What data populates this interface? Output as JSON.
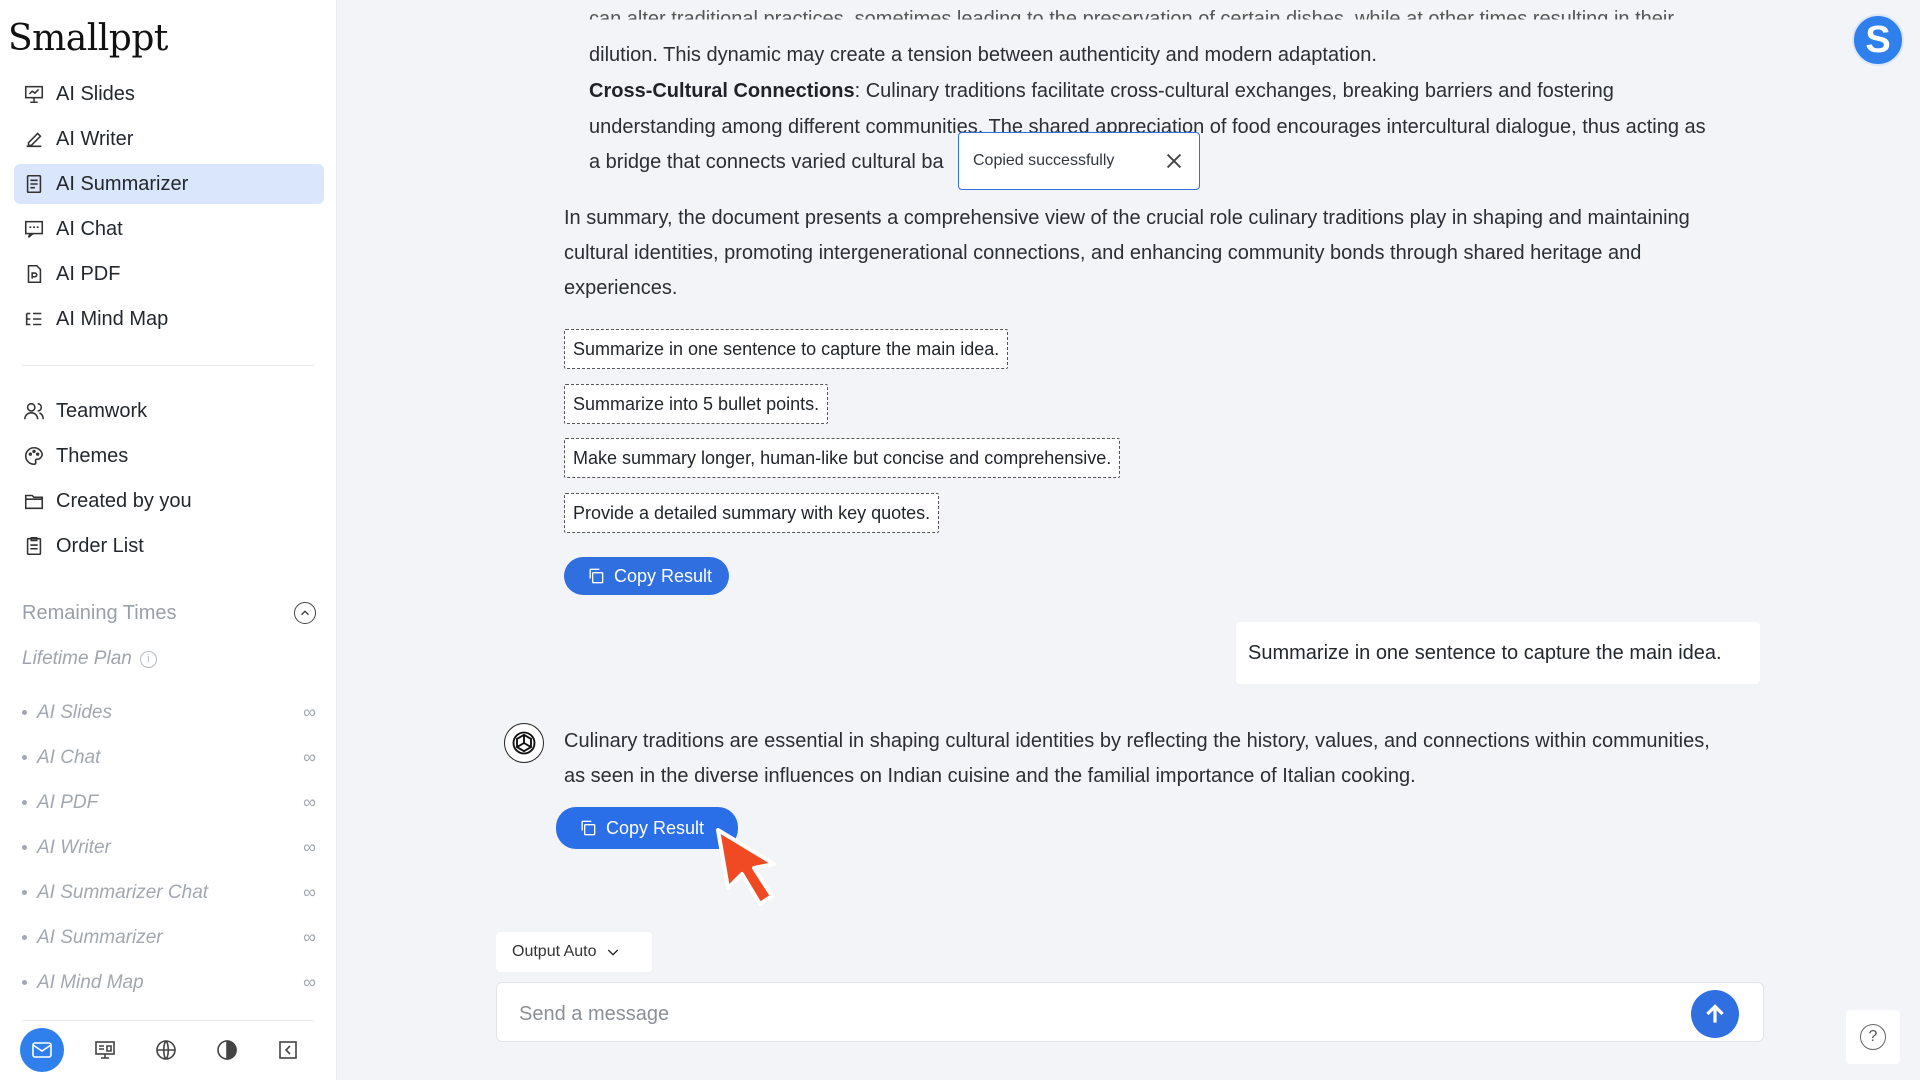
{
  "app": {
    "logo_text": "Smallppt",
    "user_initial": "S",
    "accent": "#2f6fe0"
  },
  "sidebar": {
    "nav_primary": [
      {
        "label": "AI Slides",
        "icon": "presentation-icon"
      },
      {
        "label": "AI Writer",
        "icon": "pen-icon"
      },
      {
        "label": "AI Summarizer",
        "icon": "document-icon",
        "active": true
      },
      {
        "label": "AI Chat",
        "icon": "chat-icon"
      },
      {
        "label": "AI PDF",
        "icon": "pdf-icon"
      },
      {
        "label": "AI Mind Map",
        "icon": "mindmap-icon"
      }
    ],
    "nav_secondary": [
      {
        "label": "Teamwork",
        "icon": "team-icon"
      },
      {
        "label": "Themes",
        "icon": "palette-icon"
      },
      {
        "label": "Created by you",
        "icon": "folder-icon"
      },
      {
        "label": "Order List",
        "icon": "clipboard-icon"
      }
    ],
    "remaining_title": "Remaining Times",
    "plan_label": "Lifetime Plan",
    "quota_items": [
      {
        "label": "AI Slides",
        "value": "∞"
      },
      {
        "label": "AI Chat",
        "value": "∞"
      },
      {
        "label": "AI PDF",
        "value": "∞"
      },
      {
        "label": "AI Writer",
        "value": "∞"
      },
      {
        "label": "AI Summarizer Chat",
        "value": "∞"
      },
      {
        "label": "AI Summarizer",
        "value": "∞"
      },
      {
        "label": "AI Mind Map",
        "value": "∞"
      }
    ],
    "bottom_icons": [
      "mail-icon",
      "presentation-icon",
      "globe-icon",
      "contrast-icon",
      "collapse-icon"
    ]
  },
  "chat": {
    "partial_top_line": "can alter traditional practices, sometimes leading to the preservation of certain dishes, while at other times resulting in their",
    "para1_line2": "dilution. This dynamic may create a tension between authenticity and modern adaptation.",
    "cross_title": "Cross-Cultural Connections",
    "cross_line1": ": Culinary traditions facilitate cross-cultural exchanges, breaking barriers and fostering",
    "cross_line2": "understanding among different communities. The shared appreciation of food encourages intercultural dialogue, thus acting as",
    "cross_line3": "a bridge that connects varied cultural ba",
    "summary_line1": "In summary, the document presents a comprehensive view of the crucial role culinary traditions play in shaping and maintaining",
    "summary_line2": "cultural identities, promoting intergenerational connections, and enhancing community bonds through shared heritage and",
    "summary_line3": "experiences.",
    "suggestions": [
      "Summarize in one sentence to capture the main idea.",
      "Summarize into 5 bullet points.",
      "Make summary longer, human-like but concise and comprehensive.",
      "Provide a detailed summary with key quotes."
    ],
    "copy_label": "Copy Result",
    "user_message": "Summarize in one sentence to capture the main idea.",
    "bot_line1": "Culinary traditions are essential in shaping cultural identities by reflecting the history, values, and connections within communities,",
    "bot_line2": "as seen in the diverse influences on Indian cuisine and the familial importance of Italian cooking.",
    "toast_text": "Copied successfully"
  },
  "composer": {
    "output_label": "Output Auto",
    "placeholder": "Send a message"
  }
}
